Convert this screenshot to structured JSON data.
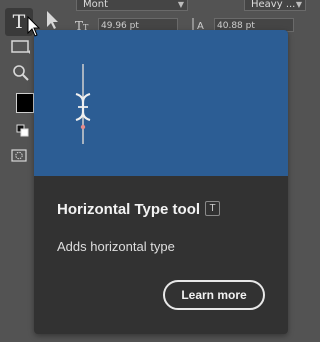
{
  "toolbar": {
    "type_tool_glyph": "T",
    "icons": [
      "type-tool-icon",
      "move-arrow-icon",
      "rectangle-tool-icon",
      "zoom-icon",
      "swap-colors-icon",
      "quick-mask-icon"
    ],
    "foreground_color": "#000000"
  },
  "options_bar": {
    "font_family": "Mont",
    "font_style": "Heavy ...",
    "font_size": "49.96 pt",
    "leading": "40.88 pt"
  },
  "tooltip": {
    "title": "Horizontal Type tool",
    "shortcut": "T",
    "description": "Adds horizontal type",
    "learn_more_label": "Learn more",
    "preview_bg": "#2c5d94"
  }
}
